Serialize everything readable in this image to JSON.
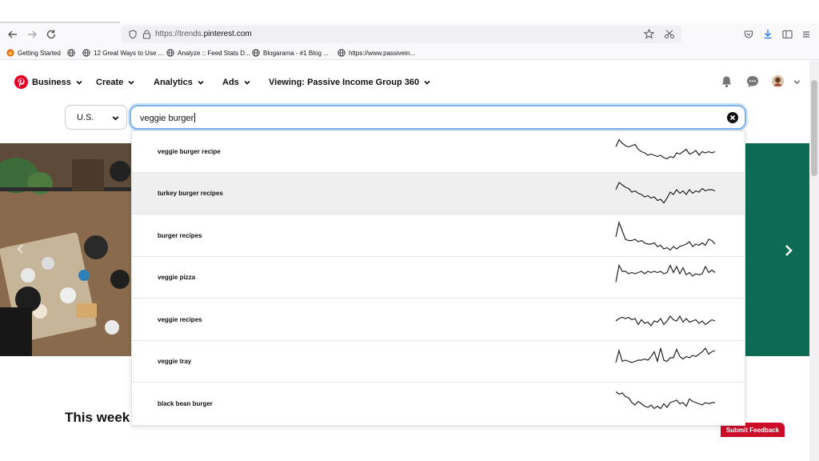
{
  "browser": {
    "url_prefix": "https://trends.",
    "url_domain": "pinterest.com",
    "bookmarks": [
      {
        "label": "Getting Started"
      },
      {
        "label": "12 Great Ways to Use ..."
      },
      {
        "label": "Analyze :: Feed Stats D..."
      },
      {
        "label": "Blogarama - #1 Blog ..."
      },
      {
        "label": "https://www.passivein..."
      }
    ]
  },
  "header": {
    "menus": [
      {
        "label": "Business"
      },
      {
        "label": "Create"
      },
      {
        "label": "Analytics"
      },
      {
        "label": "Ads"
      },
      {
        "label": "Viewing: Passive Income Group 360"
      }
    ]
  },
  "filters": {
    "country": "U.S.",
    "search_value": "veggie burger"
  },
  "suggestions": [
    {
      "label": "veggie burger recipe",
      "trend": [
        9,
        3,
        6,
        8,
        9,
        8,
        7,
        11,
        13,
        14,
        16,
        15,
        16,
        17,
        16,
        18,
        19,
        17,
        18,
        14,
        15,
        13,
        11,
        15,
        14,
        12,
        16,
        13,
        14,
        13,
        14,
        13
      ]
    },
    {
      "label": "turkey burger recipes",
      "trend": [
        10,
        4,
        6,
        8,
        9,
        12,
        11,
        13,
        14,
        16,
        15,
        17,
        16,
        19,
        18,
        21,
        17,
        12,
        14,
        10,
        13,
        11,
        14,
        10,
        13,
        11,
        12,
        9,
        11,
        10,
        10,
        11
      ]
    },
    {
      "label": "burger recipes",
      "trend": [
        14,
        2,
        9,
        16,
        17,
        17,
        16,
        18,
        17,
        19,
        20,
        20,
        19,
        22,
        21,
        24,
        23,
        25,
        22,
        24,
        22,
        21,
        20,
        18,
        22,
        20,
        21,
        19,
        21,
        16,
        17,
        20
      ]
    },
    {
      "label": "veggie pizza",
      "trend": [
        17,
        3,
        8,
        8,
        10,
        9,
        10,
        9,
        8,
        10,
        8,
        9,
        8,
        9,
        8,
        10,
        9,
        3,
        9,
        4,
        10,
        5,
        11,
        9,
        12,
        10,
        11,
        10,
        4,
        9,
        7,
        9
      ]
    },
    {
      "label": "veggie recipes",
      "trend": [
        14,
        12,
        11,
        12,
        11,
        13,
        12,
        17,
        13,
        16,
        15,
        18,
        14,
        15,
        12,
        17,
        14,
        10,
        13,
        14,
        10,
        15,
        12,
        15,
        14,
        13,
        16,
        14,
        17,
        15,
        13,
        14
      ]
    },
    {
      "label": "veggie tray",
      "trend": [
        14,
        4,
        13,
        12,
        13,
        14,
        13,
        12,
        12,
        11,
        12,
        9,
        5,
        13,
        2,
        12,
        13,
        10,
        10,
        3,
        9,
        11,
        9,
        10,
        8,
        9,
        7,
        5,
        2,
        7,
        5,
        4
      ]
    },
    {
      "label": "black bean burger",
      "trend": [
        3,
        5,
        4,
        7,
        8,
        12,
        14,
        11,
        13,
        15,
        16,
        14,
        17,
        15,
        17,
        13,
        16,
        12,
        11,
        10,
        13,
        12,
        15,
        9,
        11,
        12,
        13,
        14,
        12,
        13,
        12,
        12
      ]
    }
  ],
  "page": {
    "section_title": "This week",
    "feedback_label": "Submit Feedback"
  },
  "colors": {
    "accent": "#e60023",
    "hero_green": "#0d6b54",
    "search_focus": "#7fb4e8",
    "feedback": "#cc0d2a"
  }
}
